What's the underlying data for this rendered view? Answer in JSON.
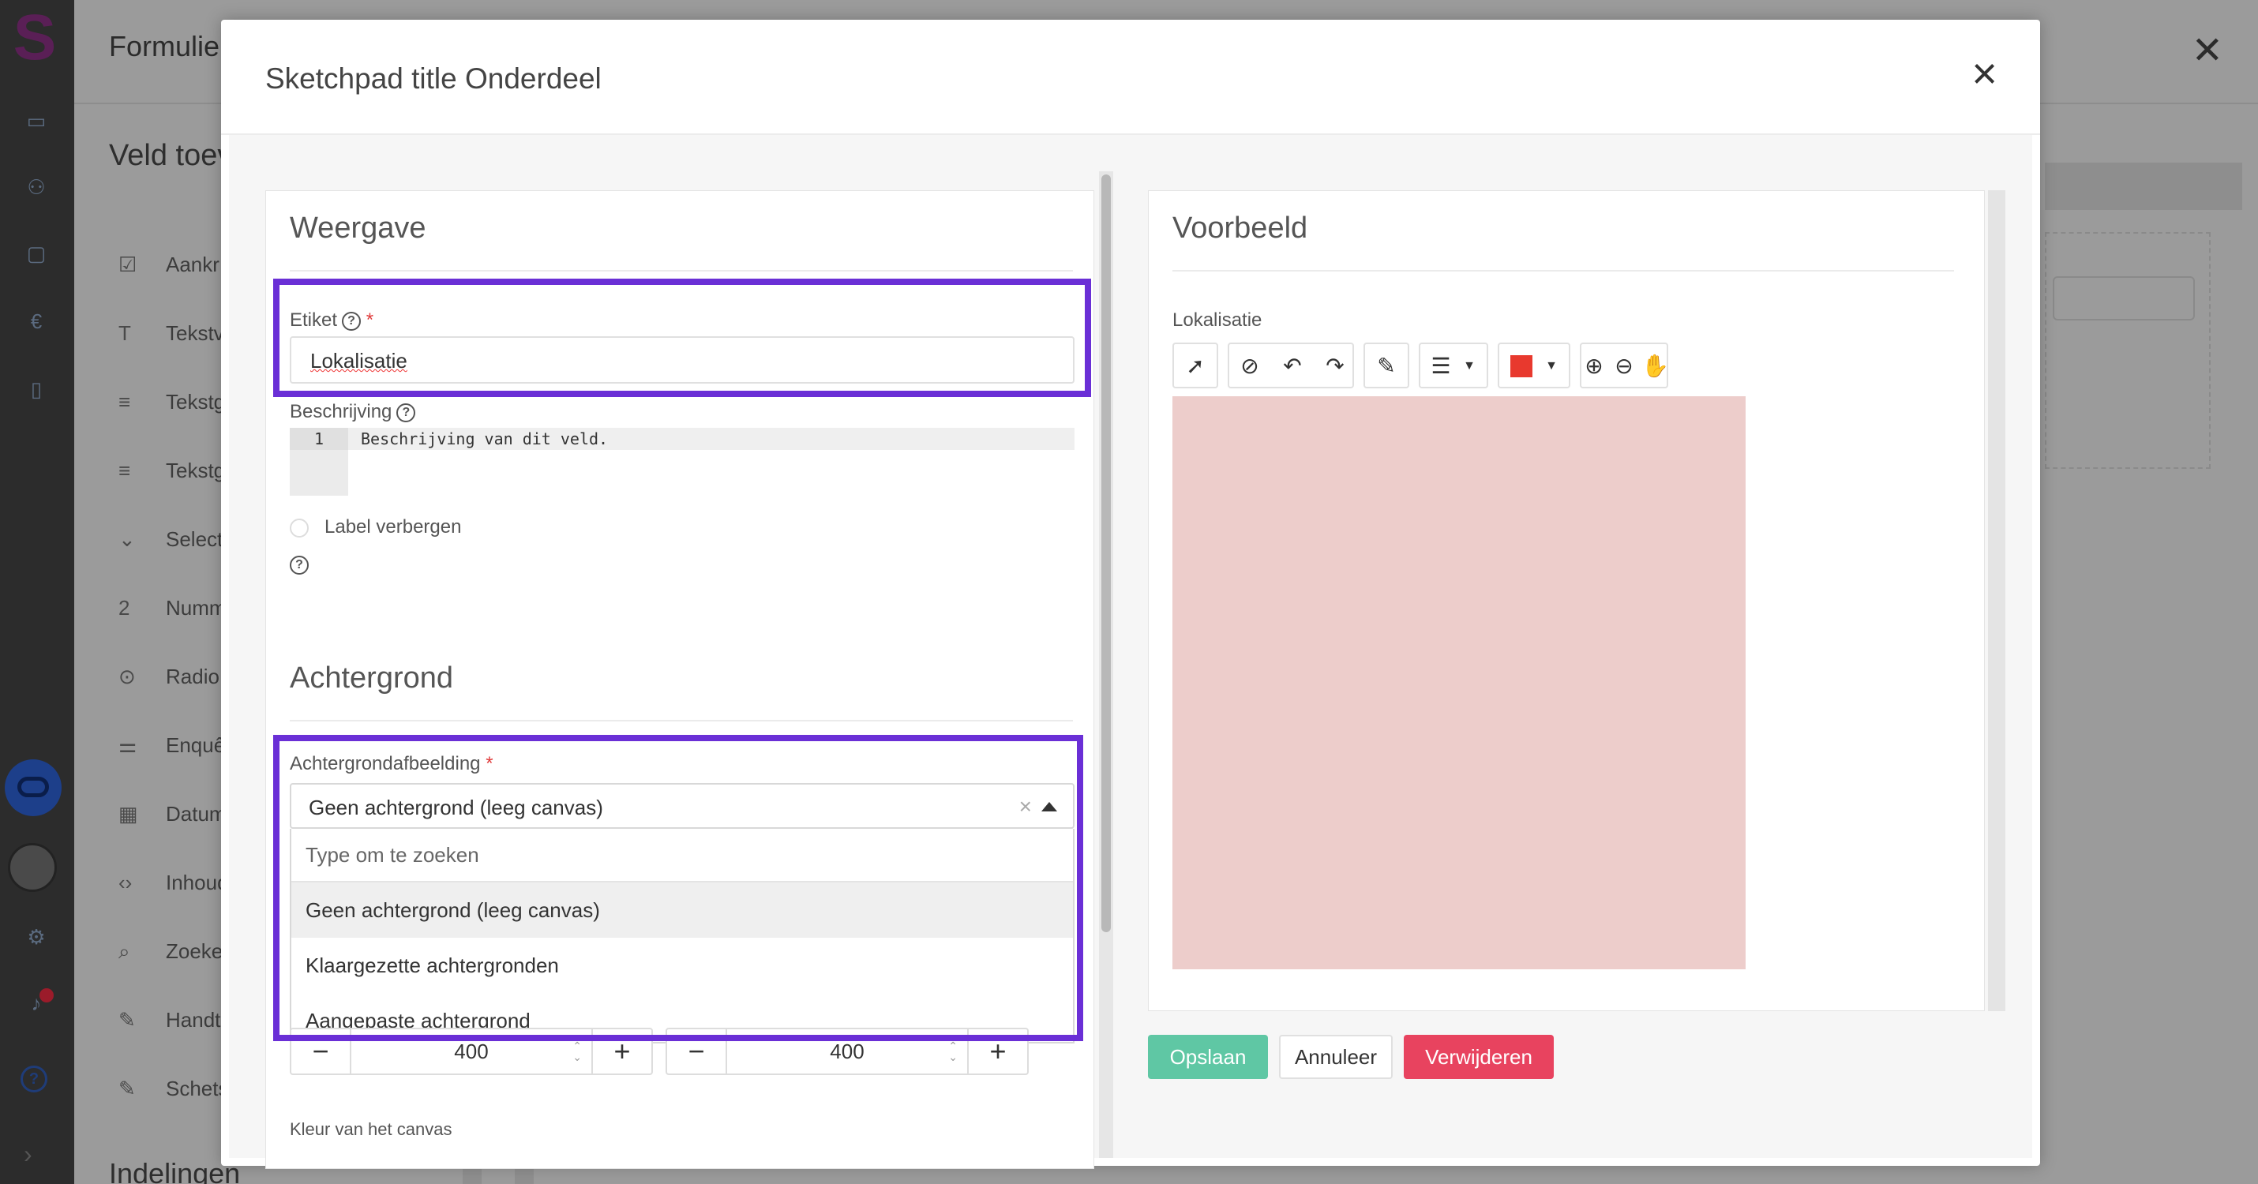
{
  "background": {
    "app_title": "Formulie",
    "section_title": "Veld toev",
    "field_types": [
      "Aankr",
      "Tekstv",
      "Tekstg",
      "Tekstg",
      "Select",
      "Numm",
      "Radio",
      "Enquê",
      "Datum",
      "Inhoud",
      "Zoeke",
      "Handt",
      "Schets"
    ],
    "footer_title": "Indelingen"
  },
  "modal": {
    "title": "Sketchpad title Onderdeel",
    "close": "×"
  },
  "weergave": {
    "heading": "Weergave",
    "label_field": {
      "label": "Etiket",
      "required": "*",
      "value": "Lokalisatie"
    },
    "description": {
      "label": "Beschrijving",
      "line_number": "1",
      "value": "Beschrijving van dit veld."
    },
    "hide_label": "Label verbergen"
  },
  "achtergrond": {
    "heading": "Achtergrond",
    "image_field": {
      "label": "Achtergrondafbeelding",
      "required": "*",
      "selected": "Geen achtergrond (leeg canvas)"
    },
    "dropdown": {
      "search_placeholder": "Type om te zoeken",
      "options": [
        "Geen achtergrond (leeg canvas)",
        "Klaargezette achtergronden",
        "Aangepaste achtergrond"
      ]
    },
    "width": "400",
    "height": "400",
    "canvas_color_label": "Kleur van het canvas"
  },
  "preview": {
    "heading": "Voorbeeld",
    "field_label": "Lokalisatie",
    "pen_color": "#e8392e",
    "canvas_color": "#edcdcb"
  },
  "actions": {
    "save": "Opslaan",
    "cancel": "Annuleer",
    "delete": "Verwijderen"
  },
  "colors": {
    "highlight": "#6a2fd6",
    "save": "#5fc7a4",
    "delete": "#e8435f"
  }
}
